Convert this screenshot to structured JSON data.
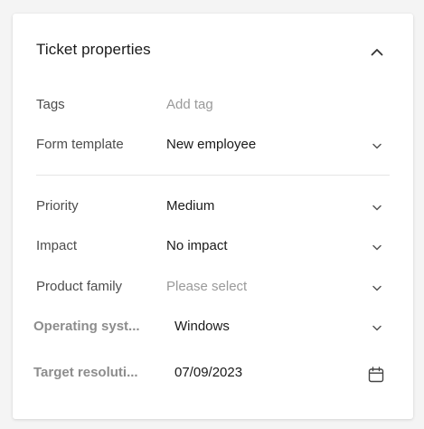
{
  "section": {
    "title": "Ticket properties",
    "collapse_icon": "chevron-up-icon"
  },
  "fields": {
    "tags": {
      "label": "Tags",
      "placeholder": "Add tag"
    },
    "form_template": {
      "label": "Form template",
      "value": "New employee",
      "icon": "chevron-down-icon"
    },
    "priority": {
      "label": "Priority",
      "value": "Medium",
      "icon": "chevron-down-icon"
    },
    "impact": {
      "label": "Impact",
      "value": "No impact",
      "icon": "chevron-down-icon"
    },
    "product_family": {
      "label": "Product family",
      "placeholder": "Please select",
      "icon": "chevron-down-icon"
    },
    "operating_system": {
      "label": "Operating syst...",
      "value": "Windows",
      "icon": "chevron-down-icon"
    },
    "target_resolution": {
      "label": "Target resoluti...",
      "value": "07/09/2023",
      "icon": "calendar-icon"
    }
  },
  "colors": {
    "card_bg": "#ffffff",
    "page_bg": "#f4f4f4",
    "text_primary": "#1a1a1a",
    "text_label": "#4d4d4d",
    "text_placeholder": "#9a9a9a",
    "icon": "#555555"
  }
}
